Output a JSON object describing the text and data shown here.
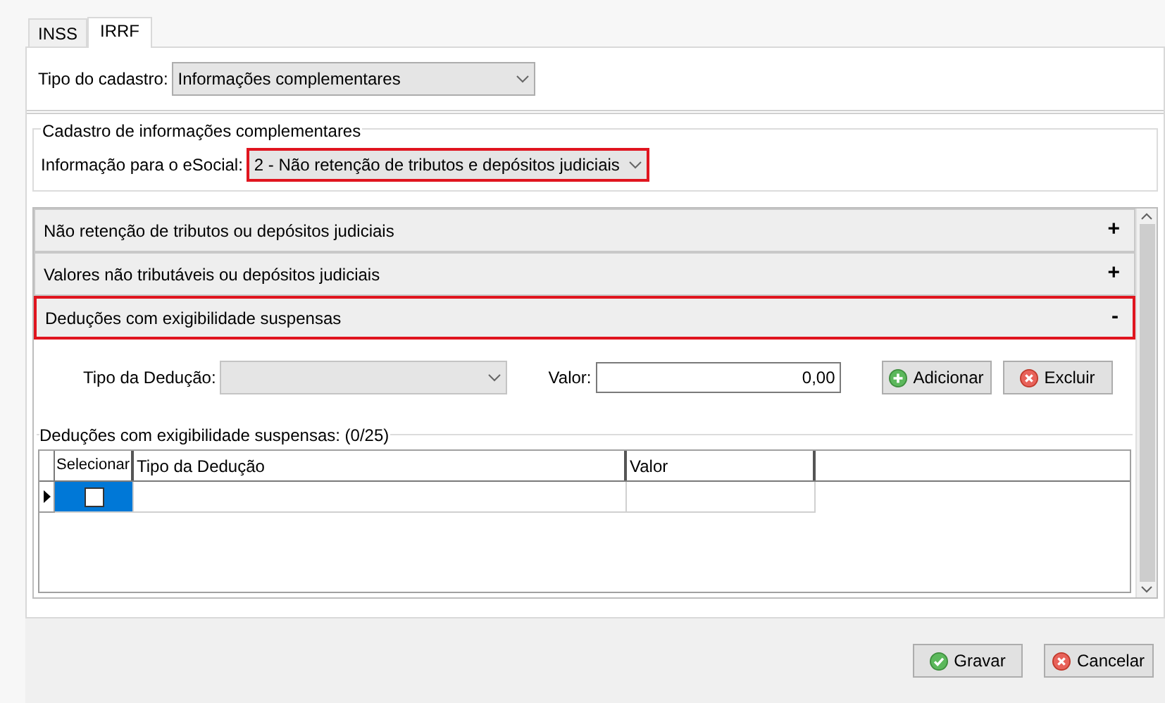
{
  "tabs": [
    {
      "label": "INSS",
      "selected": false
    },
    {
      "label": "IRRF",
      "selected": true
    }
  ],
  "tipo_cadastro": {
    "label": "Tipo do cadastro:",
    "value": "Informações complementares"
  },
  "group": {
    "title": "Cadastro de informações complementares",
    "esocial": {
      "label": "Informação para o eSocial:",
      "value": "2 - Não retenção de tributos e depósitos judiciais",
      "highlighted": true
    }
  },
  "sections": [
    {
      "title": "Não retenção de tributos ou depósitos judiciais",
      "highlighted": false,
      "toggle": "+"
    },
    {
      "title": "Valores não tributáveis ou depósitos judiciais",
      "highlighted": false,
      "toggle": "+"
    },
    {
      "title": "Deduções com exigibilidade suspensas",
      "highlighted": true,
      "toggle": "-"
    }
  ],
  "form": {
    "tipo_label": "Tipo da Dedução:",
    "valor_label": "Valor:",
    "valor_value": "0,00",
    "actions": [
      {
        "label": "Adicionar",
        "kind": "add"
      },
      {
        "label": "Excluir",
        "kind": "delete"
      }
    ]
  },
  "grid": {
    "title": "Deduções com exigibilidade suspensas: (0/25)",
    "columns": [
      "Selecionar",
      "Tipo da Dedução",
      "Valor"
    ],
    "rows": [
      {
        "current": true,
        "focused": true,
        "checked": false
      }
    ]
  },
  "buttons": [
    {
      "label": "Gravar",
      "kind": "ok"
    },
    {
      "label": "Cancelar",
      "kind": "cancel"
    }
  ]
}
